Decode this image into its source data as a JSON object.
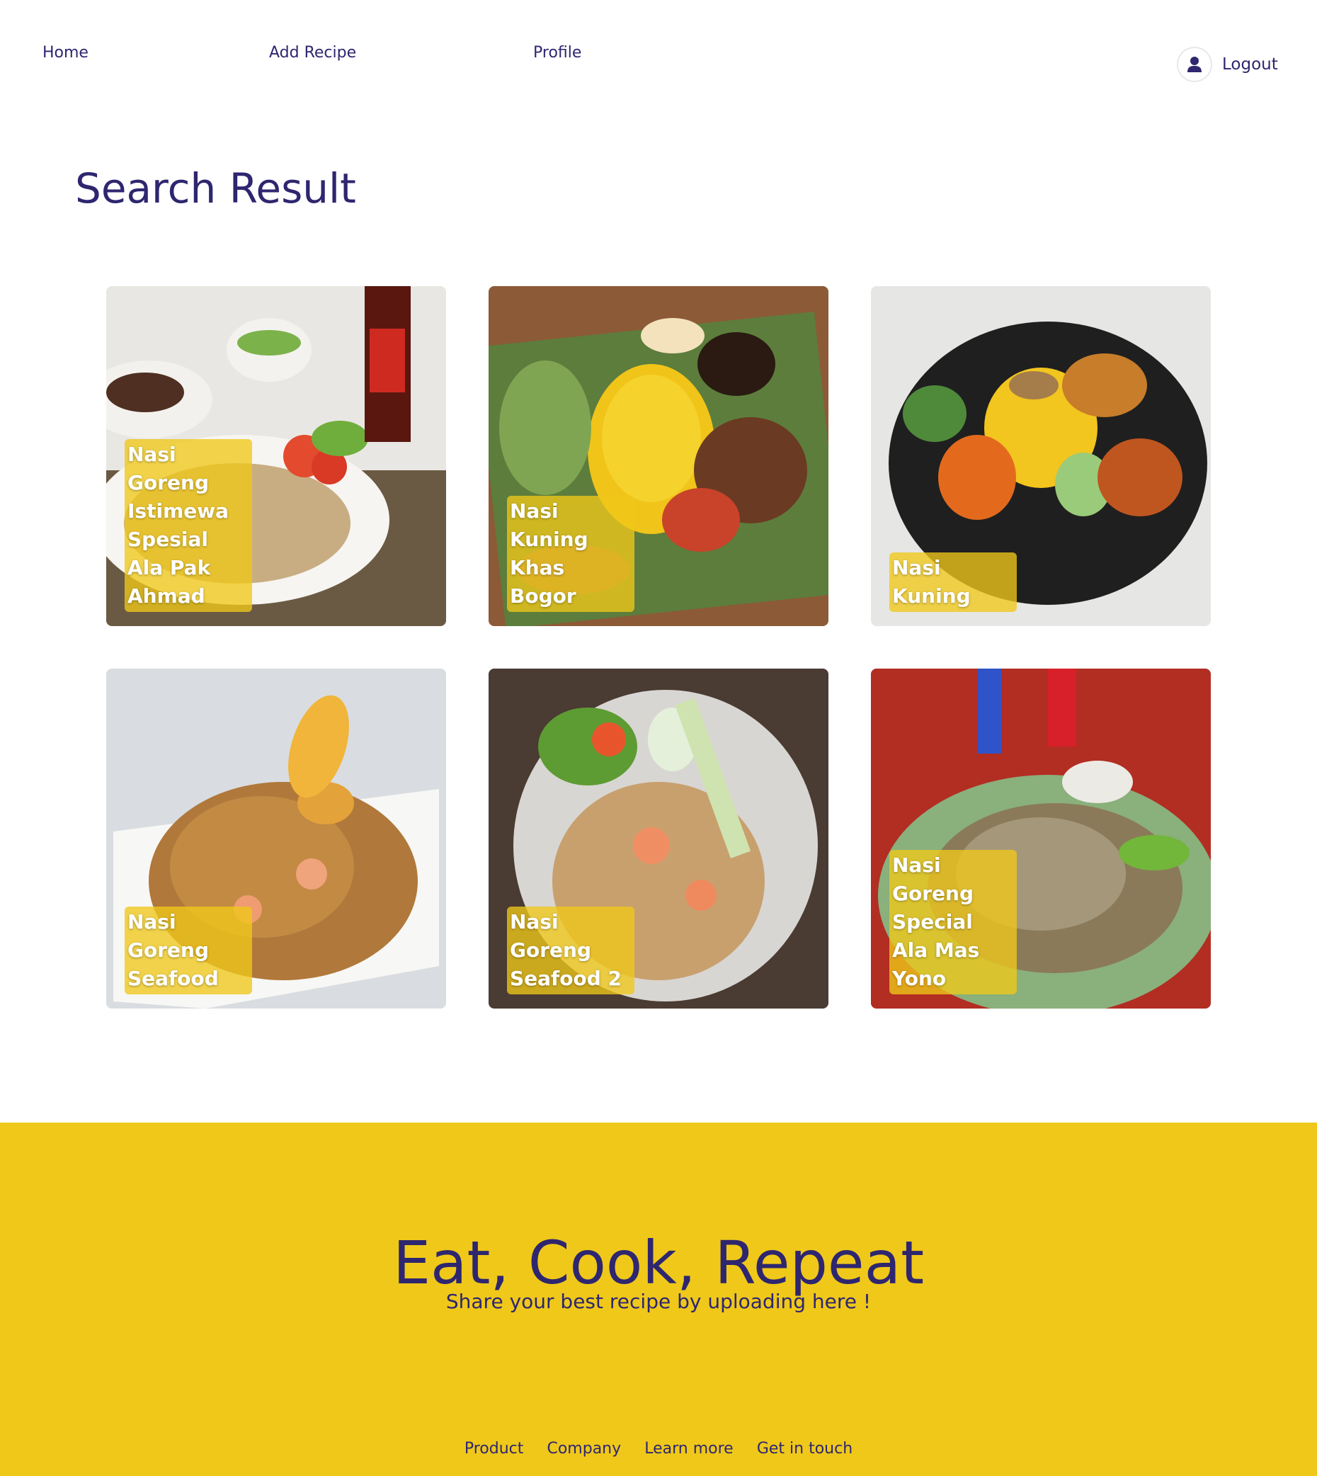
{
  "nav": {
    "home": "Home",
    "add_recipe": "Add Recipe",
    "profile": "Profile",
    "logout": "Logout",
    "avatar_icon": "user-icon"
  },
  "main": {
    "title": "Search Result",
    "recipes": [
      {
        "name": "Nasi Goreng Istimewa Spesial Ala Pak Ahmad"
      },
      {
        "name": "Nasi Kuning Khas Bogor"
      },
      {
        "name": "Nasi Kuning"
      },
      {
        "name": "Nasi Goreng Seafood"
      },
      {
        "name": "Nasi Goreng Seafood 2"
      },
      {
        "name": "Nasi Goreng Special Ala Mas Yono"
      }
    ]
  },
  "footer": {
    "title": "Eat, Cook, Repeat",
    "subtitle": "Share your best recipe by uploading here !",
    "links": [
      "Product",
      "Company",
      "Learn more",
      "Get in touch"
    ]
  },
  "colors": {
    "primary": "#2e266f",
    "accent": "#efc81a",
    "label_bg": "rgba(239,200,26,0.78)",
    "background": "#ffffff"
  }
}
